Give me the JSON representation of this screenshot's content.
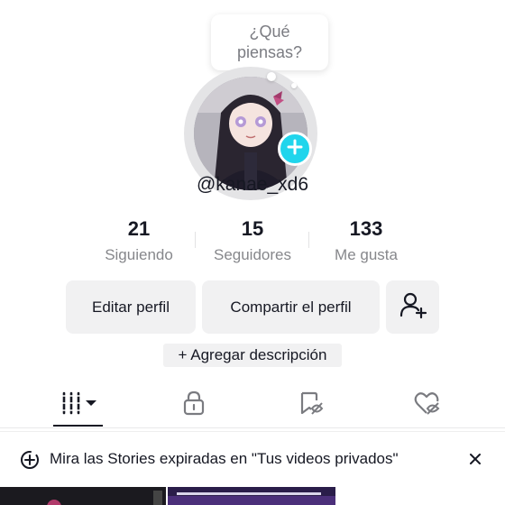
{
  "bubble": {
    "line1": "¿Qué",
    "line2": "piensas?"
  },
  "profile": {
    "username": "@kanae_xd6"
  },
  "stats": [
    {
      "value": "21",
      "label": "Siguiendo"
    },
    {
      "value": "15",
      "label": "Seguidores"
    },
    {
      "value": "133",
      "label": "Me gusta"
    }
  ],
  "buttons": {
    "edit": "Editar perfil",
    "share": "Compartir el perfil",
    "add_friend_icon": "person-add-icon"
  },
  "description": {
    "label": "+ Agregar descripción"
  },
  "tabs": [
    {
      "icon": "videos-grid-icon",
      "active": true
    },
    {
      "icon": "lock-icon",
      "active": false
    },
    {
      "icon": "saved-icon",
      "active": false
    },
    {
      "icon": "liked-hidden-icon",
      "active": false
    }
  ],
  "banner": {
    "icon": "story-plus-icon",
    "text": "Mira las Stories expiradas en \"Tus videos privados\"",
    "close_icon": "close-icon"
  },
  "colors": {
    "accent": "#20d5ec",
    "button_bg": "#f1f1f2",
    "secondary_text": "#86878b"
  }
}
